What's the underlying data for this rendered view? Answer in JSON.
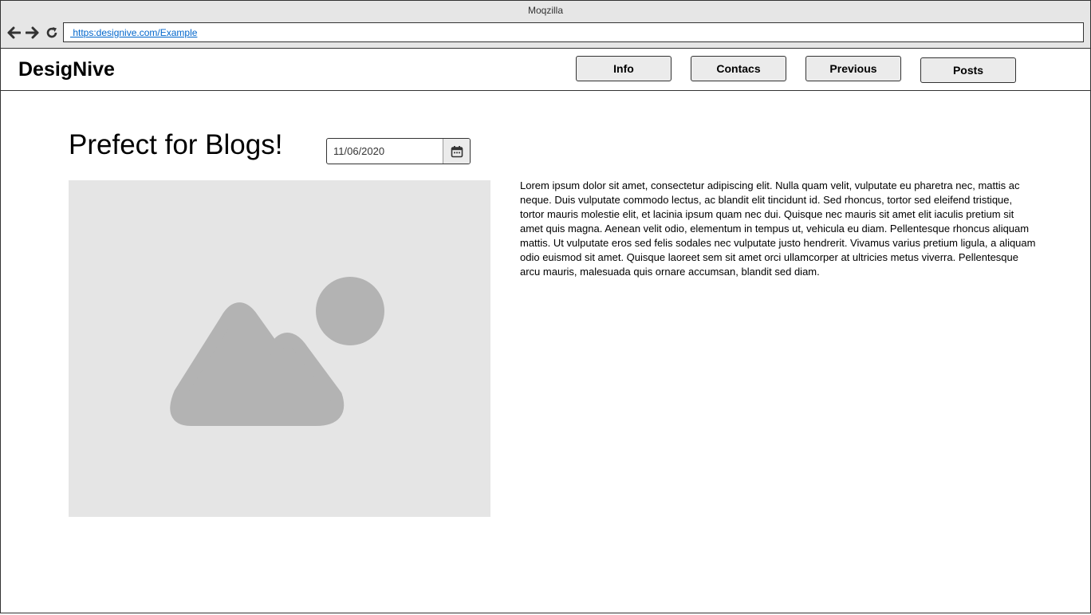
{
  "browser": {
    "title": "Moqzilla",
    "url": " https:designive.com/Example",
    "back_icon": "arrow-left-icon",
    "forward_icon": "arrow-right-icon",
    "reload_icon": "reload-icon"
  },
  "header": {
    "logo": "DesigNive",
    "nav": [
      {
        "label": "Info"
      },
      {
        "label": "Contacs"
      },
      {
        "label": "Previous"
      },
      {
        "label": "Posts"
      }
    ]
  },
  "main": {
    "title": "Prefect for Blogs!",
    "date_value": "11/06/2020",
    "calendar_icon": "calendar-icon",
    "image_icon": "image-placeholder-icon",
    "body": "Lorem ipsum dolor sit amet, consectetur adipiscing elit. Nulla quam velit, vulputate eu pharetra nec, mattis ac neque. Duis vulputate commodo lectus, ac blandit elit tincidunt id. Sed rhoncus, tortor sed eleifend tristique, tortor mauris molestie elit, et lacinia ipsum quam nec dui. Quisque nec mauris sit amet elit iaculis pretium sit amet quis magna. Aenean velit odio, elementum in tempus ut, vehicula eu diam. Pellentesque rhoncus aliquam mattis. Ut vulputate eros sed felis sodales nec vulputate justo hendrerit. Vivamus varius pretium ligula, a aliquam odio euismod sit amet. Quisque laoreet sem sit amet orci ullamcorper at ultricies metus viverra. Pellentesque arcu mauris, malesuada quis ornare accumsan, blandit sed diam."
  }
}
